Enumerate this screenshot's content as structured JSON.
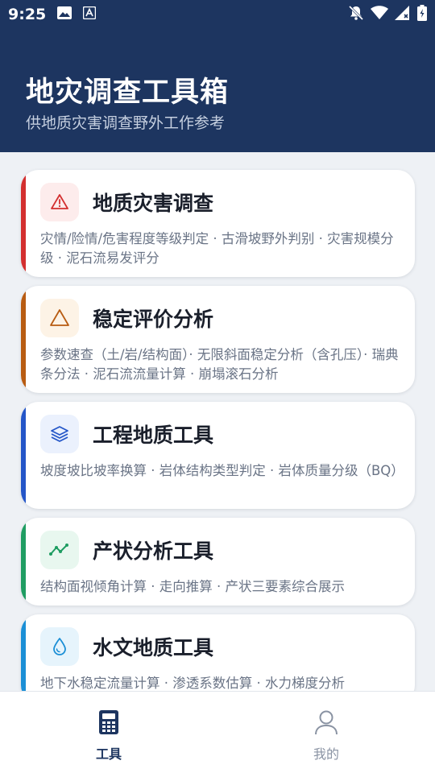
{
  "status_bar": {
    "time": "9:25"
  },
  "header": {
    "title": "地灾调查工具箱",
    "subtitle": "供地质灾害调查野外工作参考"
  },
  "cards": [
    {
      "title": "地质灾害调查",
      "description": "灾情/险情/危害程度等级判定 · 古滑坡野外判别 · 灾害规模分级 · 泥石流易发评分",
      "icon": "warning-triangle-icon",
      "accent": "#d32f2f",
      "icon_bg": "#fdecec"
    },
    {
      "title": "稳定评价分析",
      "description": "参数速查（土/岩/结构面）· 无限斜面稳定分析（含孔压）· 瑞典条分法 · 泥石流流量计算 · 崩塌滚石分析",
      "icon": "triangle-outline-icon",
      "accent": "#b85c12",
      "icon_bg": "#fdf3e6"
    },
    {
      "title": "工程地质工具",
      "description": "坡度坡比坡率换算 · 岩体结构类型判定 · 岩体质量分级（BQ）",
      "icon": "layers-icon",
      "accent": "#2456c8",
      "icon_bg": "#ebf1fd"
    },
    {
      "title": "产状分析工具",
      "description": "结构面视倾角计算 · 走向推算 · 产状三要素综合展示",
      "icon": "trend-line-icon",
      "accent": "#1f9d62",
      "icon_bg": "#e8f7ef"
    },
    {
      "title": "水文地质工具",
      "description": "地下水稳定流量计算 · 渗透系数估算 · 水力梯度分析",
      "icon": "water-drop-icon",
      "accent": "#1b8fd6",
      "icon_bg": "#e6f4fc"
    }
  ],
  "bottom_nav": [
    {
      "label": "工具",
      "icon": "calculator-icon",
      "active": true
    },
    {
      "label": "我的",
      "icon": "person-icon",
      "active": false
    }
  ]
}
